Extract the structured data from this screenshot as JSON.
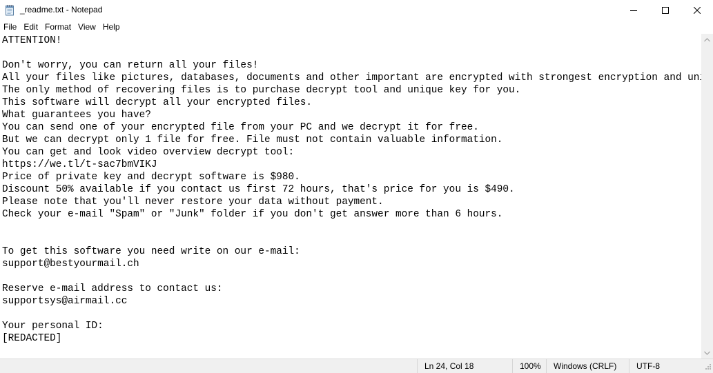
{
  "window": {
    "title": "_readme.txt - Notepad",
    "icon": "notepad-icon"
  },
  "menu": [
    "File",
    "Edit",
    "Format",
    "View",
    "Help"
  ],
  "document": {
    "lines": [
      "ATTENTION!",
      "",
      "Don't worry, you can return all your files!",
      "All your files like pictures, databases, documents and other important are encrypted with strongest encryption and unique key.",
      "The only method of recovering files is to purchase decrypt tool and unique key for you.",
      "This software will decrypt all your encrypted files.",
      "What guarantees you have?",
      "You can send one of your encrypted file from your PC and we decrypt it for free.",
      "But we can decrypt only 1 file for free. File must not contain valuable information.",
      "You can get and look video overview decrypt tool:",
      "https://we.tl/t-sac7bmVIKJ",
      "Price of private key and decrypt software is $980.",
      "Discount 50% available if you contact us first 72 hours, that's price for you is $490.",
      "Please note that you'll never restore your data without payment.",
      "Check your e-mail \"Spam\" or \"Junk\" folder if you don't get answer more than 6 hours.",
      "",
      "",
      "To get this software you need write on our e-mail:",
      "support@bestyourmail.ch",
      "",
      "Reserve e-mail address to contact us:",
      "supportsys@airmail.cc",
      "",
      "Your personal ID:",
      "[REDACTED]"
    ]
  },
  "status": {
    "position": "Ln 24, Col 18",
    "zoom": "100%",
    "line_ending": "Windows (CRLF)",
    "encoding": "UTF-8"
  }
}
